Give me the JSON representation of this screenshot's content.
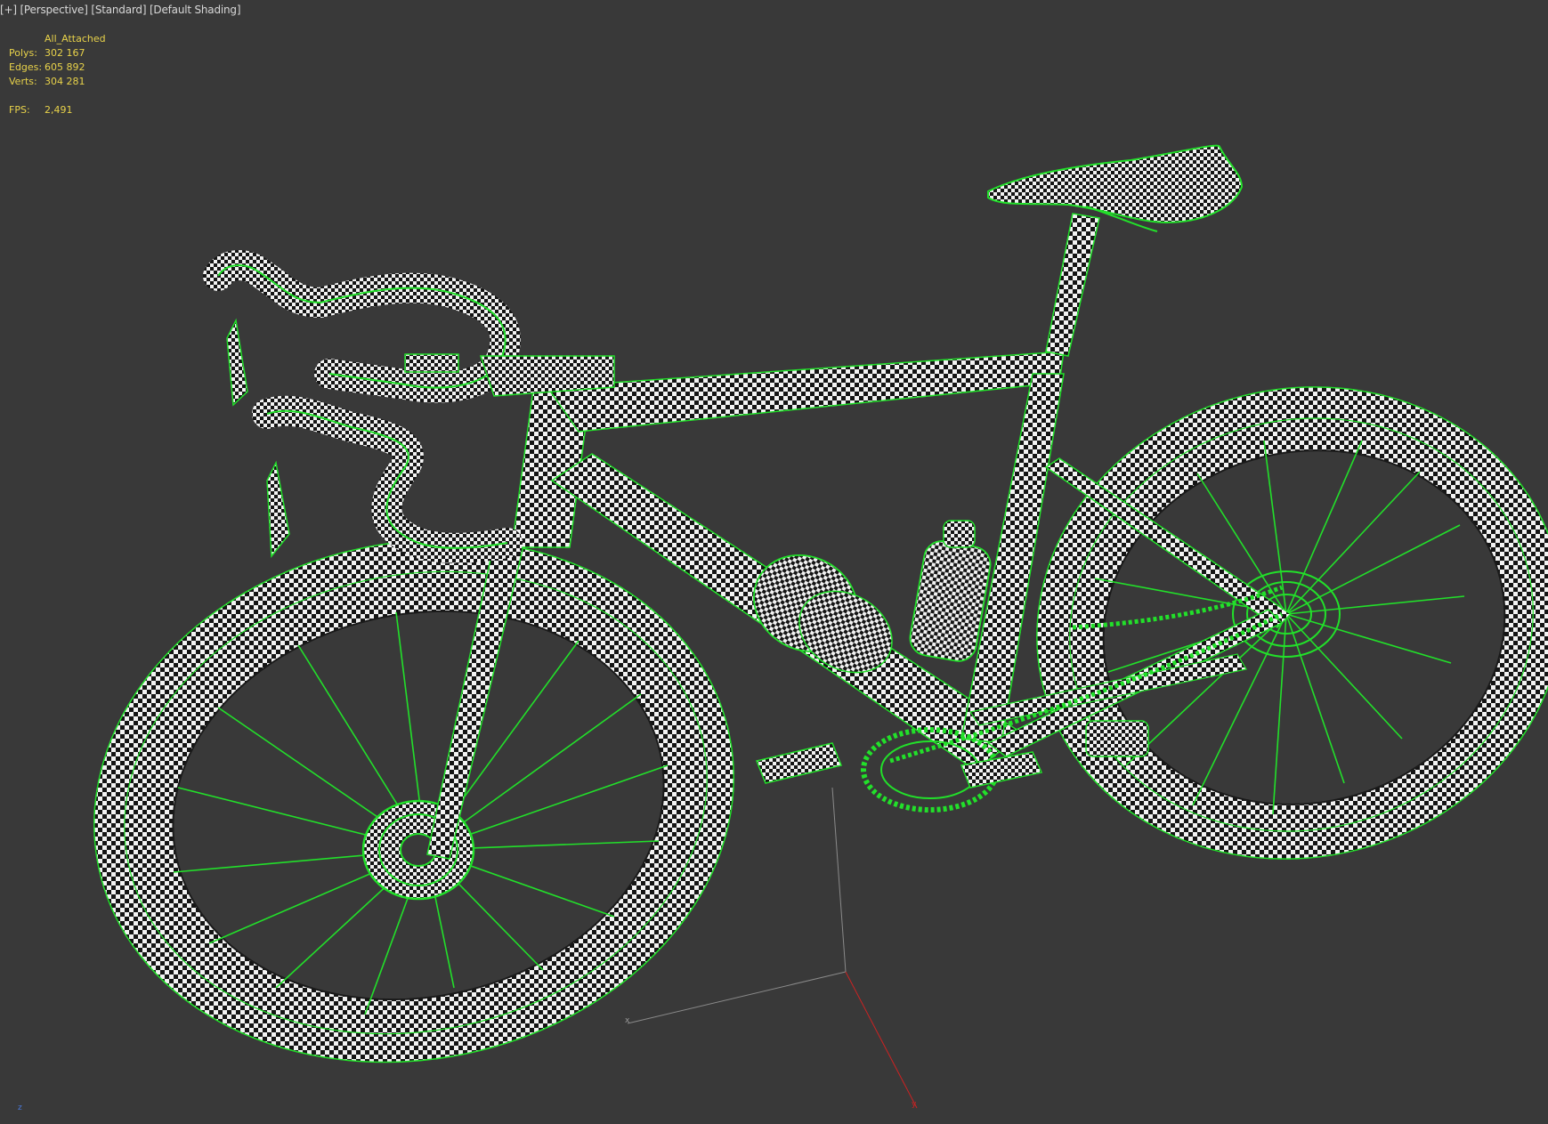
{
  "viewport": {
    "menu_plus": "[+]",
    "view_label": "[Perspective]",
    "render_label": "[Standard]",
    "shading_label": "[Default Shading]"
  },
  "stats": {
    "object_name": "All_Attached",
    "polys_label": "Polys:",
    "polys_value": "302 167",
    "edges_label": "Edges:",
    "edges_value": "605 892",
    "verts_label": "Verts:",
    "verts_value": "304 281",
    "fps_label": "FPS:",
    "fps_value": "2,491"
  },
  "gizmo": {
    "x_label": "x",
    "y_label": "y",
    "z_label": "z"
  },
  "colors": {
    "background": "#393939",
    "selection_wire": "#22e02a",
    "stats_text": "#e8d24a",
    "axis_x": "#d03030",
    "axis_grid": "#8a8a8a"
  },
  "scene": {
    "model": "bicycle",
    "material": "checker"
  }
}
